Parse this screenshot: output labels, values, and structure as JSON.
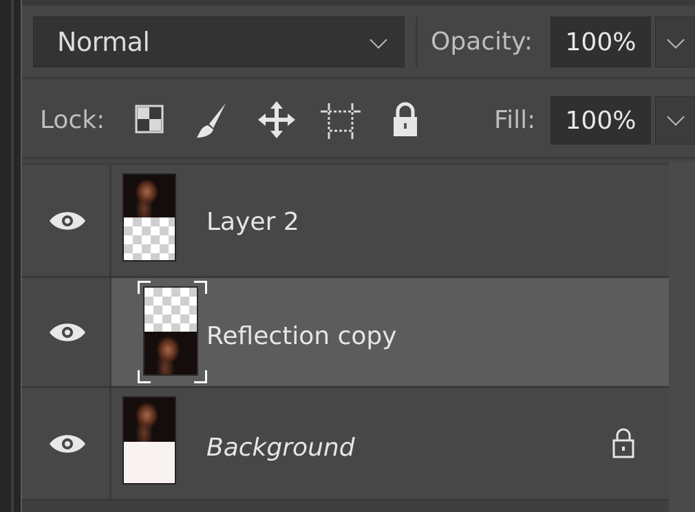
{
  "blend_mode": {
    "value": "Normal"
  },
  "opacity": {
    "label": "Opacity:",
    "value": "100%"
  },
  "lock": {
    "label": "Lock:",
    "icons": [
      "lock-transparent-pixels-icon",
      "lock-image-pixels-icon",
      "lock-position-icon",
      "lock-artboard-icon",
      "lock-all-icon"
    ]
  },
  "fill": {
    "label": "Fill:",
    "value": "100%"
  },
  "layers": [
    {
      "name": "Layer 2",
      "visible": true,
      "selected": false,
      "locked": false,
      "italic": false
    },
    {
      "name": "Reflection copy",
      "visible": true,
      "selected": true,
      "locked": false,
      "italic": false
    },
    {
      "name": "Background",
      "visible": true,
      "selected": false,
      "locked": true,
      "italic": true
    }
  ],
  "colors": {
    "panel": "#454545",
    "selected_row": "#5c5c5c",
    "text": "#e6e6e6"
  }
}
